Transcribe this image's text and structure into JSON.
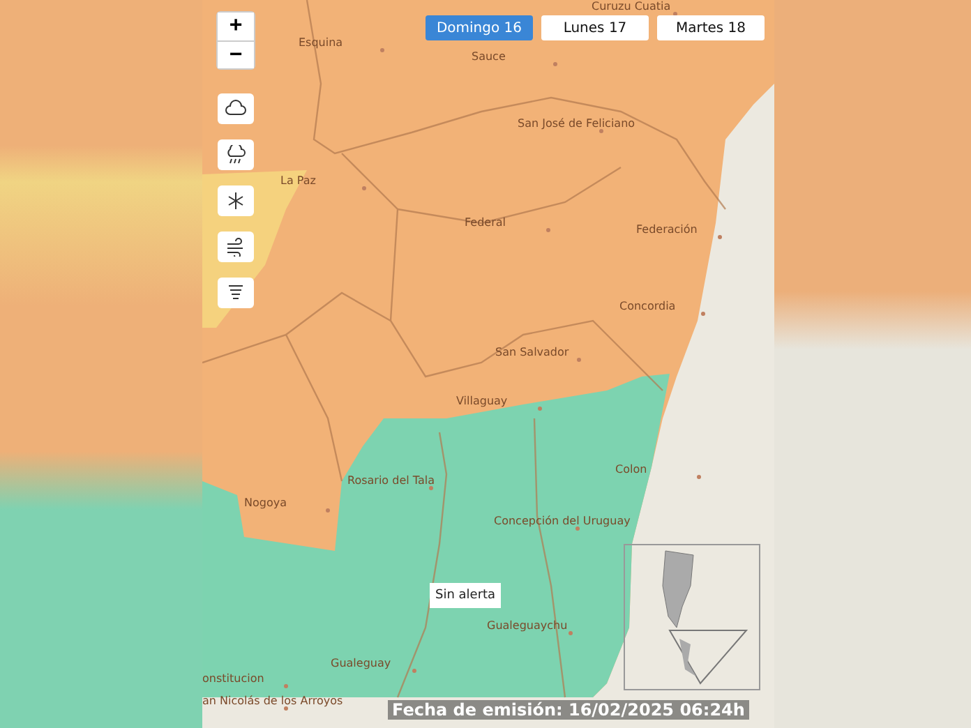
{
  "day_tabs": [
    {
      "label": "Domingo 16",
      "selected": true
    },
    {
      "label": "Lunes 17",
      "selected": false
    },
    {
      "label": "Martes 18",
      "selected": false
    }
  ],
  "zoom_controls": [
    "+",
    "−"
  ],
  "places": [
    "Curuzu Cuatia",
    "Esquina",
    "Sauce",
    "San José de Feliciano",
    "La Paz",
    "Federal",
    "Federación",
    "Concordia",
    "San Salvador",
    "Villaguay",
    "Nogoya",
    "Rosario del Tala",
    "Colon",
    "Concepción del Uruguay",
    "Gualeguaychu",
    "Gualeguay",
    "onstitucion",
    "an Nicolás de los  Arroyos"
  ],
  "popup": "Sin alerta",
  "footer": "Fecha de emisión: 16/02/2025 06:24h"
}
